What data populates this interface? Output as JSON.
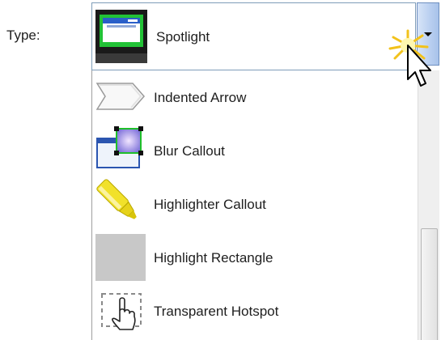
{
  "field": {
    "label": "Type:"
  },
  "combo": {
    "selected": "Spotlight",
    "icon": "spotlight-icon"
  },
  "dropdown": {
    "items": [
      {
        "label": "Indented Arrow",
        "icon": "indented-arrow-icon"
      },
      {
        "label": "Blur Callout",
        "icon": "blur-callout-icon"
      },
      {
        "label": "Highlighter Callout",
        "icon": "highlighter-icon"
      },
      {
        "label": "Highlight Rectangle",
        "icon": "highlight-rectangle-icon"
      },
      {
        "label": "Transparent Hotspot",
        "icon": "transparent-hotspot-icon"
      }
    ]
  },
  "colors": {
    "spotlight_green": "#22c236",
    "combo_border": "#7f9db9",
    "highlighter_yellow": "#e8d400",
    "highlight_rect_gray": "#c8c8c8"
  }
}
